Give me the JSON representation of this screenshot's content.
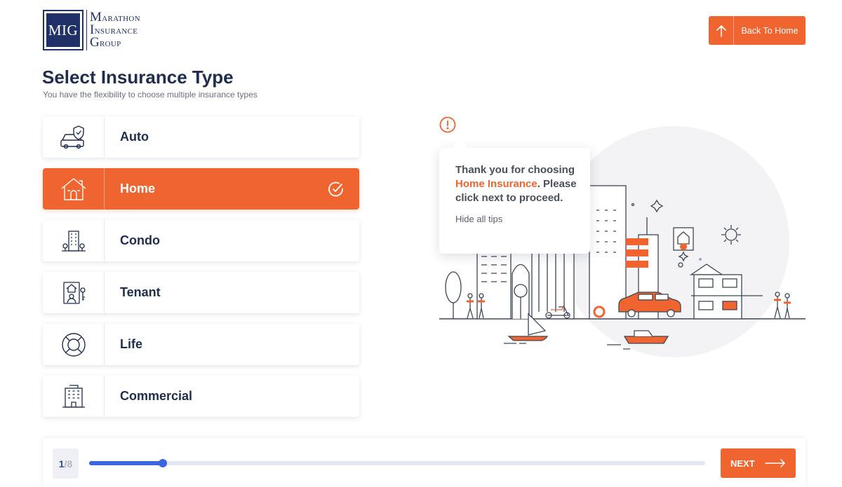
{
  "header": {
    "logo_mark": "MIG",
    "logo_lines": [
      "Marathon",
      "Insurance",
      "Group"
    ],
    "back_label": "Back To Home"
  },
  "page": {
    "title": "Select Insurance Type",
    "subtitle": "You have the flexibility to choose multiple insurance types"
  },
  "options": [
    {
      "label": "Auto",
      "icon": "car-shield-icon",
      "selected": false
    },
    {
      "label": "Home",
      "icon": "house-icon",
      "selected": true
    },
    {
      "label": "Condo",
      "icon": "condo-building-icon",
      "selected": false
    },
    {
      "label": "Tenant",
      "icon": "tenant-icon",
      "selected": false
    },
    {
      "label": "Life",
      "icon": "lifebuoy-icon",
      "selected": false
    },
    {
      "label": "Commercial",
      "icon": "office-building-icon",
      "selected": false
    }
  ],
  "tip": {
    "msg_pre": "Thank you for choosing ",
    "msg_highlight": "Home Insurance",
    "msg_post": ". Please click next to proceed.",
    "hide_label": "Hide all tips"
  },
  "progress": {
    "current": "1",
    "separator": "/",
    "total": "8",
    "fraction": 0.12
  },
  "footer": {
    "next_label": "NEXT"
  },
  "colors": {
    "accent": "#f06430",
    "navy": "#1f2d4e",
    "progress": "#3a64e0"
  }
}
